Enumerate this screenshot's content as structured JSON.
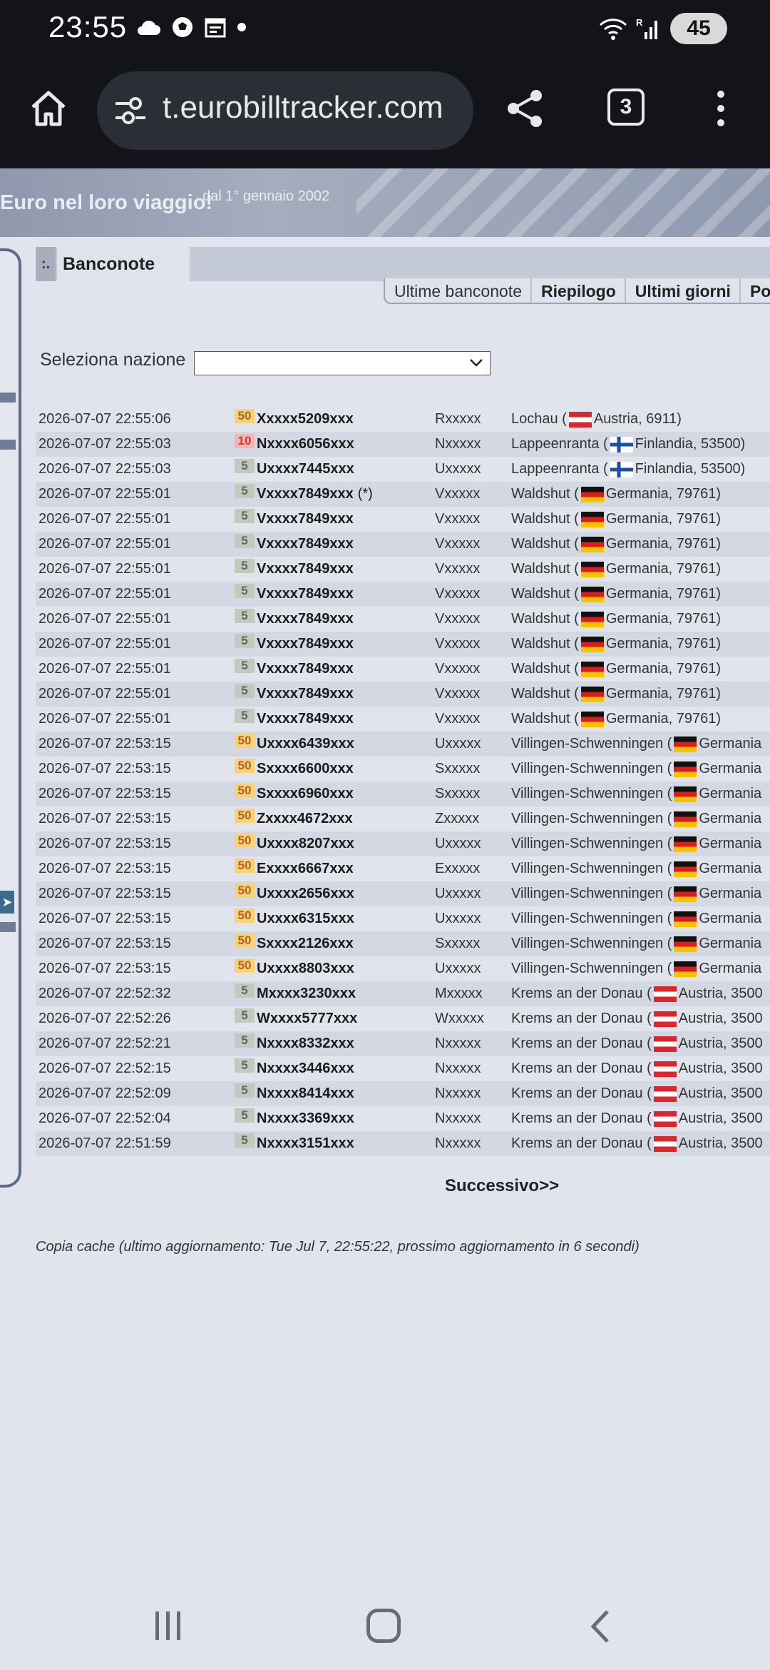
{
  "status_bar": {
    "time": "23:55",
    "battery": "45"
  },
  "browser": {
    "url": "t.eurobilltracker.com",
    "tab_count": "3"
  },
  "banner": {
    "title": "Euro nel loro viaggio!",
    "subtitle": "dal 1° gennaio 2002"
  },
  "panel": {
    "bullet": ":.",
    "title": "Banconote",
    "tabs": [
      "Ultime banconote",
      "Riepilogo",
      "Ultimi giorni",
      "Polig"
    ]
  },
  "country_filter": {
    "label": "Seleziona nazione",
    "value": ""
  },
  "notes": [
    {
      "date": "2026-07-07 22:55:06",
      "den": "50",
      "serial": "Xxxxx5209xxx",
      "star": "",
      "prefix": "Rxxxxx",
      "city": "Lochau (",
      "flag": "at",
      "country": "Austria, 6911)"
    },
    {
      "date": "2026-07-07 22:55:03",
      "den": "10",
      "serial": "Nxxxx6056xxx",
      "star": "",
      "prefix": "Nxxxxx",
      "city": "Lappeenranta (",
      "flag": "fi",
      "country": "Finlandia, 53500)"
    },
    {
      "date": "2026-07-07 22:55:03",
      "den": "5",
      "serial": "Uxxxx7445xxx",
      "star": "",
      "prefix": "Uxxxxx",
      "city": "Lappeenranta (",
      "flag": "fi",
      "country": "Finlandia, 53500)"
    },
    {
      "date": "2026-07-07 22:55:01",
      "den": "5",
      "serial": "Vxxxx7849xxx",
      "star": "(*)",
      "prefix": "Vxxxxx",
      "city": "Waldshut (",
      "flag": "de",
      "country": "Germania, 79761)"
    },
    {
      "date": "2026-07-07 22:55:01",
      "den": "5",
      "serial": "Vxxxx7849xxx",
      "star": "",
      "prefix": "Vxxxxx",
      "city": "Waldshut (",
      "flag": "de",
      "country": "Germania, 79761)"
    },
    {
      "date": "2026-07-07 22:55:01",
      "den": "5",
      "serial": "Vxxxx7849xxx",
      "star": "",
      "prefix": "Vxxxxx",
      "city": "Waldshut (",
      "flag": "de",
      "country": "Germania, 79761)"
    },
    {
      "date": "2026-07-07 22:55:01",
      "den": "5",
      "serial": "Vxxxx7849xxx",
      "star": "",
      "prefix": "Vxxxxx",
      "city": "Waldshut (",
      "flag": "de",
      "country": "Germania, 79761)"
    },
    {
      "date": "2026-07-07 22:55:01",
      "den": "5",
      "serial": "Vxxxx7849xxx",
      "star": "",
      "prefix": "Vxxxxx",
      "city": "Waldshut (",
      "flag": "de",
      "country": "Germania, 79761)"
    },
    {
      "date": "2026-07-07 22:55:01",
      "den": "5",
      "serial": "Vxxxx7849xxx",
      "star": "",
      "prefix": "Vxxxxx",
      "city": "Waldshut (",
      "flag": "de",
      "country": "Germania, 79761)"
    },
    {
      "date": "2026-07-07 22:55:01",
      "den": "5",
      "serial": "Vxxxx7849xxx",
      "star": "",
      "prefix": "Vxxxxx",
      "city": "Waldshut (",
      "flag": "de",
      "country": "Germania, 79761)"
    },
    {
      "date": "2026-07-07 22:55:01",
      "den": "5",
      "serial": "Vxxxx7849xxx",
      "star": "",
      "prefix": "Vxxxxx",
      "city": "Waldshut (",
      "flag": "de",
      "country": "Germania, 79761)"
    },
    {
      "date": "2026-07-07 22:55:01",
      "den": "5",
      "serial": "Vxxxx7849xxx",
      "star": "",
      "prefix": "Vxxxxx",
      "city": "Waldshut (",
      "flag": "de",
      "country": "Germania, 79761)"
    },
    {
      "date": "2026-07-07 22:55:01",
      "den": "5",
      "serial": "Vxxxx7849xxx",
      "star": "",
      "prefix": "Vxxxxx",
      "city": "Waldshut (",
      "flag": "de",
      "country": "Germania, 79761)"
    },
    {
      "date": "2026-07-07 22:53:15",
      "den": "50",
      "serial": "Uxxxx6439xxx",
      "star": "",
      "prefix": "Uxxxxx",
      "city": "Villingen-Schwenningen (",
      "flag": "de",
      "country": "Germania"
    },
    {
      "date": "2026-07-07 22:53:15",
      "den": "50",
      "serial": "Sxxxx6600xxx",
      "star": "",
      "prefix": "Sxxxxx",
      "city": "Villingen-Schwenningen (",
      "flag": "de",
      "country": "Germania"
    },
    {
      "date": "2026-07-07 22:53:15",
      "den": "50",
      "serial": "Sxxxx6960xxx",
      "star": "",
      "prefix": "Sxxxxx",
      "city": "Villingen-Schwenningen (",
      "flag": "de",
      "country": "Germania"
    },
    {
      "date": "2026-07-07 22:53:15",
      "den": "50",
      "serial": "Zxxxx4672xxx",
      "star": "",
      "prefix": "Zxxxxx",
      "city": "Villingen-Schwenningen (",
      "flag": "de",
      "country": "Germania"
    },
    {
      "date": "2026-07-07 22:53:15",
      "den": "50",
      "serial": "Uxxxx8207xxx",
      "star": "",
      "prefix": "Uxxxxx",
      "city": "Villingen-Schwenningen (",
      "flag": "de",
      "country": "Germania"
    },
    {
      "date": "2026-07-07 22:53:15",
      "den": "50",
      "serial": "Exxxx6667xxx",
      "star": "",
      "prefix": "Exxxxx",
      "city": "Villingen-Schwenningen (",
      "flag": "de",
      "country": "Germania"
    },
    {
      "date": "2026-07-07 22:53:15",
      "den": "50",
      "serial": "Uxxxx2656xxx",
      "star": "",
      "prefix": "Uxxxxx",
      "city": "Villingen-Schwenningen (",
      "flag": "de",
      "country": "Germania"
    },
    {
      "date": "2026-07-07 22:53:15",
      "den": "50",
      "serial": "Uxxxx6315xxx",
      "star": "",
      "prefix": "Uxxxxx",
      "city": "Villingen-Schwenningen (",
      "flag": "de",
      "country": "Germania"
    },
    {
      "date": "2026-07-07 22:53:15",
      "den": "50",
      "serial": "Sxxxx2126xxx",
      "star": "",
      "prefix": "Sxxxxx",
      "city": "Villingen-Schwenningen (",
      "flag": "de",
      "country": "Germania"
    },
    {
      "date": "2026-07-07 22:53:15",
      "den": "50",
      "serial": "Uxxxx8803xxx",
      "star": "",
      "prefix": "Uxxxxx",
      "city": "Villingen-Schwenningen (",
      "flag": "de",
      "country": "Germania"
    },
    {
      "date": "2026-07-07 22:52:32",
      "den": "5",
      "serial": "Mxxxx3230xxx",
      "star": "",
      "prefix": "Mxxxxx",
      "city": "Krems an der Donau (",
      "flag": "at",
      "country": "Austria, 3500"
    },
    {
      "date": "2026-07-07 22:52:26",
      "den": "5",
      "serial": "Wxxxx5777xxx",
      "star": "",
      "prefix": "Wxxxxx",
      "city": "Krems an der Donau (",
      "flag": "at",
      "country": "Austria, 3500"
    },
    {
      "date": "2026-07-07 22:52:21",
      "den": "5",
      "serial": "Nxxxx8332xxx",
      "star": "",
      "prefix": "Nxxxxx",
      "city": "Krems an der Donau (",
      "flag": "at",
      "country": "Austria, 3500"
    },
    {
      "date": "2026-07-07 22:52:15",
      "den": "5",
      "serial": "Nxxxx3446xxx",
      "star": "",
      "prefix": "Nxxxxx",
      "city": "Krems an der Donau (",
      "flag": "at",
      "country": "Austria, 3500"
    },
    {
      "date": "2026-07-07 22:52:09",
      "den": "5",
      "serial": "Nxxxx8414xxx",
      "star": "",
      "prefix": "Nxxxxx",
      "city": "Krems an der Donau (",
      "flag": "at",
      "country": "Austria, 3500"
    },
    {
      "date": "2026-07-07 22:52:04",
      "den": "5",
      "serial": "Nxxxx3369xxx",
      "star": "",
      "prefix": "Nxxxxx",
      "city": "Krems an der Donau (",
      "flag": "at",
      "country": "Austria, 3500"
    },
    {
      "date": "2026-07-07 22:51:59",
      "den": "5",
      "serial": "Nxxxx3151xxx",
      "star": "",
      "prefix": "Nxxxxx",
      "city": "Krems an der Donau (",
      "flag": "at",
      "country": "Austria, 3500"
    }
  ],
  "pagination": {
    "next_label": "Successivo>>"
  },
  "cache_note": "Copia cache (ultimo aggiornamento: Tue Jul 7, 22:55:22, prossimo aggiornamento in 6 secondi)",
  "icons": {
    "status": [
      "cloud-icon",
      "soccer-ball-icon",
      "calendar-icon",
      "dot-icon",
      "wifi-icon",
      "signal-icon",
      "battery-icon"
    ],
    "browser": [
      "home-icon",
      "site-settings-icon",
      "share-icon",
      "tabs-icon",
      "more-vert-icon"
    ],
    "nav": [
      "recents-icon",
      "home-icon",
      "back-icon"
    ]
  }
}
